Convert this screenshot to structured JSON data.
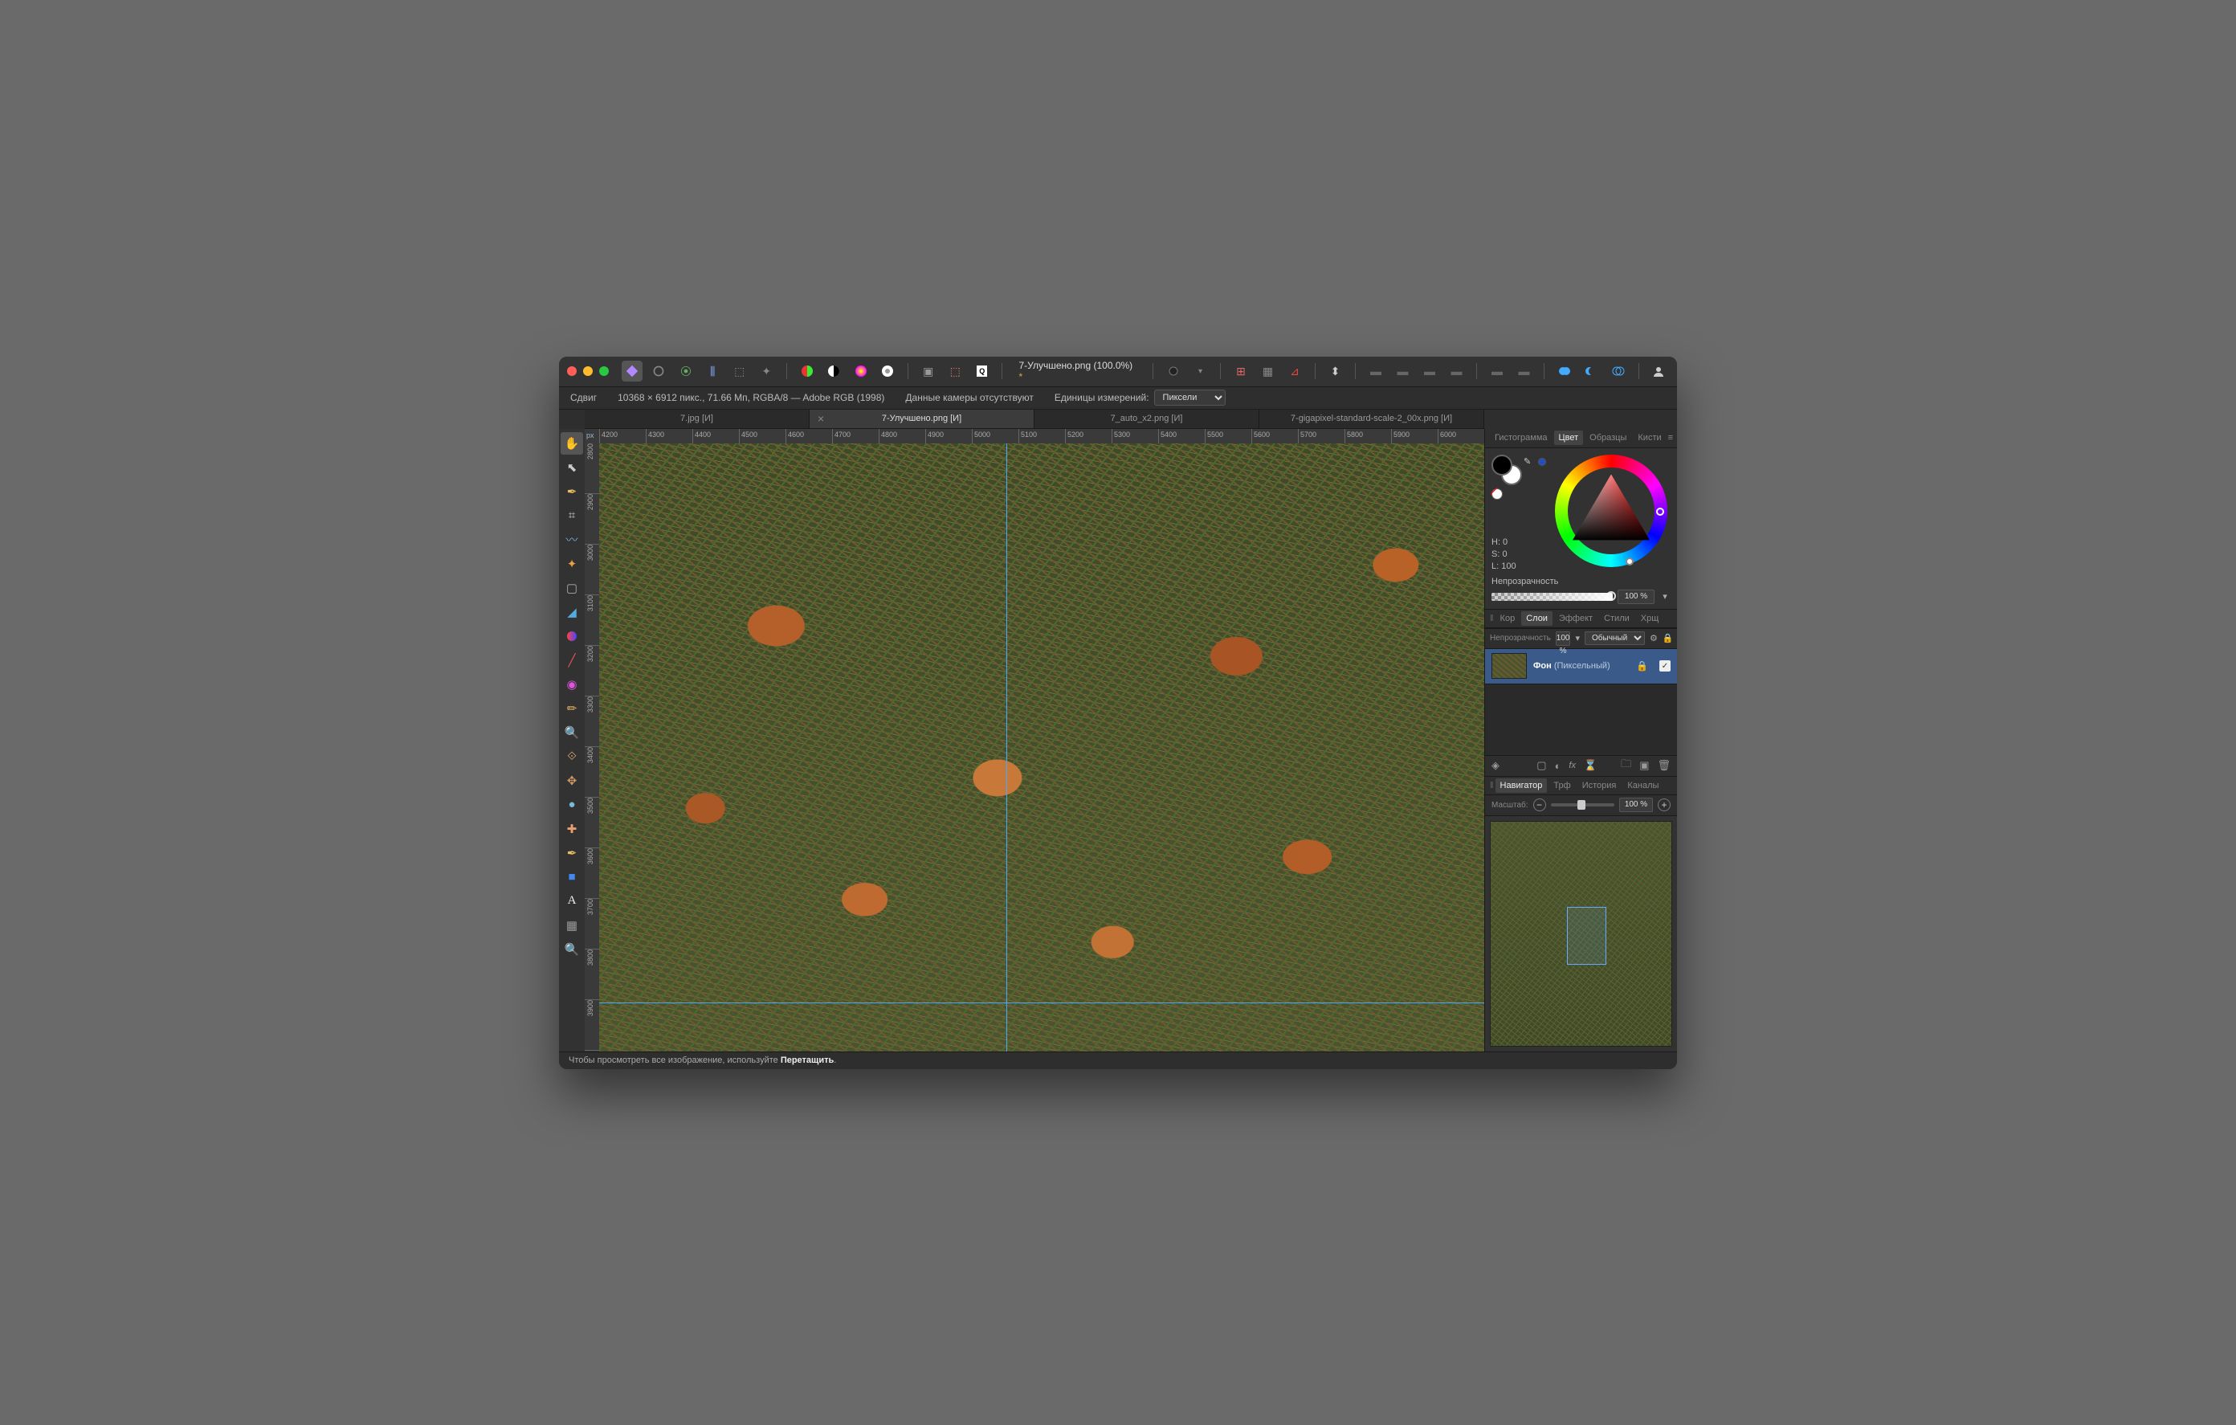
{
  "traffic": {
    "close": "#ff5f57",
    "min": "#febc2e",
    "max": "#28c840"
  },
  "titlebar": {
    "docTitle": "7-Улучшено.png (100.0%)",
    "modified": "*"
  },
  "infobar": {
    "toolName": "Сдвиг",
    "docInfo": "10368 × 6912 пикс., 71.66 Мп, RGBA/8 — Adobe RGB (1998)",
    "camera": "Данные камеры отсутствуют",
    "unitsLabel": "Единицы измерений:",
    "unitsValue": "Пиксели"
  },
  "docTabs": [
    {
      "label": "7.jpg [И]",
      "active": false
    },
    {
      "label": "7-Улучшено.png [И]",
      "active": true
    },
    {
      "label": "7_auto_x2.png [И]",
      "active": false
    },
    {
      "label": "7-gigapixel-standard-scale-2_00x.png [И]",
      "active": false
    }
  ],
  "ruler": {
    "unit": "px",
    "hTicks": [
      "4200",
      "4300",
      "4400",
      "4500",
      "4600",
      "4700",
      "4800",
      "4900",
      "5000",
      "5100",
      "5200",
      "5300",
      "5400",
      "5500",
      "5600",
      "5700",
      "5800",
      "5900",
      "6000"
    ],
    "vTicks": [
      "2800",
      "2900",
      "3000",
      "3100",
      "3200",
      "3300",
      "3400",
      "3500",
      "3600",
      "3700",
      "3800",
      "3900"
    ]
  },
  "status": {
    "prefix": "Чтобы просмотреть все изображение, используйте ",
    "bold": "Перетащить",
    "suffix": "."
  },
  "rightTop": {
    "tabs": [
      "Гистограмма",
      "Цвет",
      "Образцы",
      "Кисти"
    ],
    "active": "Цвет"
  },
  "color": {
    "h": "H: 0",
    "s": "S: 0",
    "l": "L: 100",
    "opacityLabel": "Непрозрачность",
    "opacityValue": "100 %"
  },
  "layersTabs": {
    "tabs": [
      "Кор",
      "Слои",
      "Эффект",
      "Стили",
      "Хрщ"
    ],
    "active": "Слои"
  },
  "layersHead": {
    "opLabel": "Непрозрачность",
    "opValue": "100 %",
    "blend": "Обычный"
  },
  "layer": {
    "name": "Фон",
    "type": "(Пиксельный)"
  },
  "navTabs": {
    "tabs": [
      "Навигатор",
      "Трф",
      "История",
      "Каналы"
    ],
    "active": "Навигатор"
  },
  "nav": {
    "zoomLabel": "Масштаб:",
    "zoomValue": "100 %"
  }
}
